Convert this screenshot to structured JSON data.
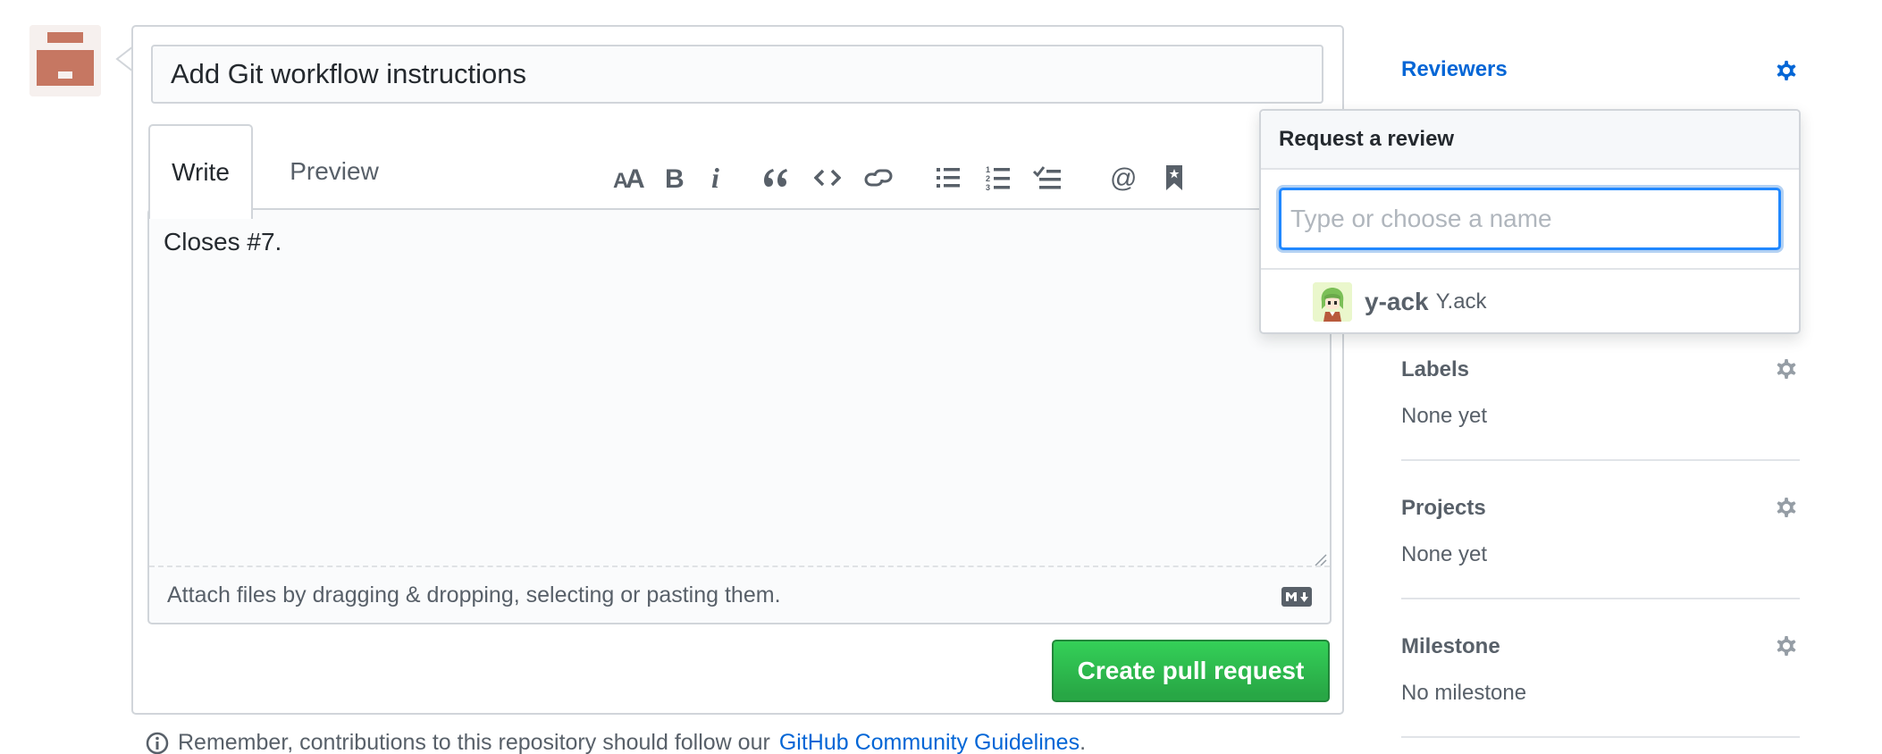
{
  "pull_request": {
    "title_value": "Add Git workflow instructions",
    "tabs": [
      {
        "label": "Write",
        "selected": true
      },
      {
        "label": "Preview",
        "selected": false
      }
    ],
    "toolbar": {
      "icons": [
        "text-size-icon",
        "bold-icon",
        "italic-icon",
        "quote-icon",
        "code-icon",
        "link-icon",
        "bulleted-list-icon",
        "numbered-list-icon",
        "task-list-icon",
        "mention-icon",
        "bookmark-icon"
      ]
    },
    "body_value": "Closes #7.",
    "attach_hint": "Attach files by dragging & dropping, selecting or pasting them.",
    "submit_label": "Create pull request"
  },
  "footer_note": {
    "text": "Remember, contributions to this repository should follow our",
    "link_text": "GitHub Community Guidelines",
    "trailing": "."
  },
  "sidebar": {
    "reviewers": {
      "heading": "Reviewers"
    },
    "labels": {
      "heading": "Labels",
      "value": "None yet"
    },
    "projects": {
      "heading": "Projects",
      "value": "None yet"
    },
    "milestone": {
      "heading": "Milestone",
      "value": "No milestone"
    }
  },
  "review_popover": {
    "header": "Request a review",
    "filter_placeholder": "Type or choose a name",
    "filter_value": "",
    "suggestions": [
      {
        "login": "y-ack",
        "name": "Y.ack"
      }
    ]
  },
  "colors": {
    "link": "#0366d6",
    "primary_button": "#28a745",
    "focus_ring": "#2188ff",
    "avatar_brick": "#c67762"
  }
}
